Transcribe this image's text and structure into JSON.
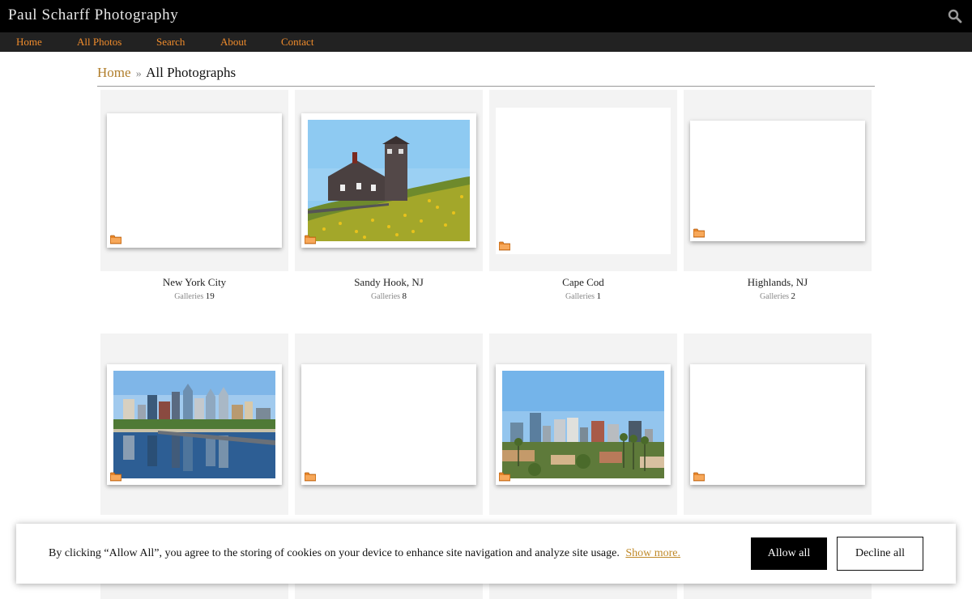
{
  "header": {
    "site_title": "Paul Scharff Photography",
    "search_icon": "search-icon"
  },
  "nav": {
    "items": [
      {
        "label": "Home"
      },
      {
        "label": "All Photos"
      },
      {
        "label": "Search"
      },
      {
        "label": "About"
      },
      {
        "label": "Contact"
      }
    ]
  },
  "breadcrumb": {
    "home": "Home",
    "separator": "»",
    "current": "All Photographs"
  },
  "galleries": [
    {
      "name": "New York City",
      "meta_label": "Galleries",
      "count": "19",
      "thumbnail": "blank"
    },
    {
      "name": "Sandy Hook, NJ",
      "meta_label": "Galleries",
      "count": "8",
      "thumbnail": "lighthouse-station"
    },
    {
      "name": "Cape Cod",
      "meta_label": "Galleries",
      "count": "1",
      "thumbnail": "blank"
    },
    {
      "name": "Highlands, NJ",
      "meta_label": "Galleries",
      "count": "2",
      "thumbnail": "blank"
    },
    {
      "name": "",
      "meta_label": "",
      "count": "",
      "thumbnail": "city-skyline-river"
    },
    {
      "name": "",
      "meta_label": "",
      "count": "",
      "thumbnail": "blank"
    },
    {
      "name": "",
      "meta_label": "",
      "count": "",
      "thumbnail": "desert-city-skyline"
    },
    {
      "name": "",
      "meta_label": "",
      "count": "",
      "thumbnail": "blank"
    }
  ],
  "cookie_banner": {
    "text": "By clicking “Allow All”, you agree to the storing of cookies on your device to enhance site navigation and analyze site usage.",
    "link": "Show more.",
    "allow_label": "Allow all",
    "decline_label": "Decline all"
  },
  "colors": {
    "header_bg": "#000000",
    "nav_bg": "#222222",
    "nav_link": "#f08c2c",
    "breadcrumb_link": "#b07d2a",
    "folder": "#e8862a"
  }
}
